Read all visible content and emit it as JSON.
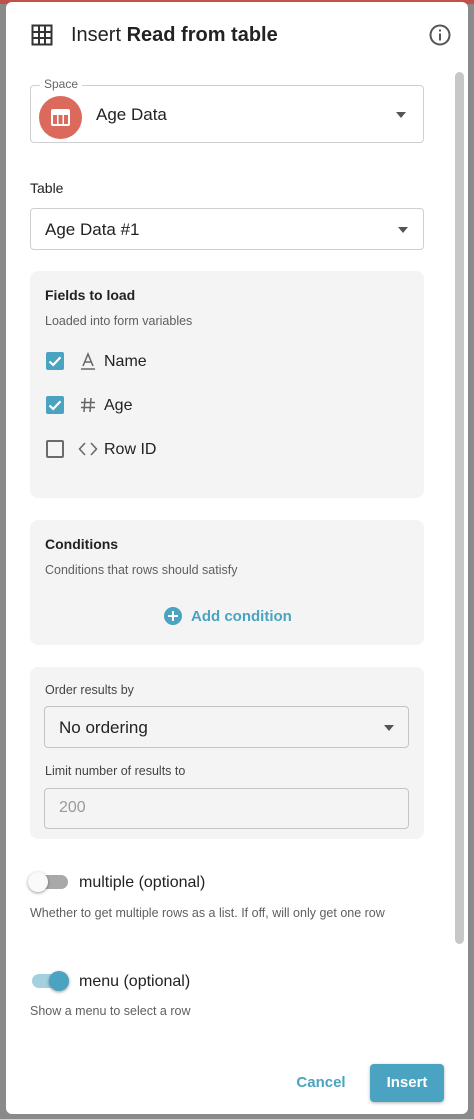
{
  "dialog": {
    "title_prefix": "Insert ",
    "title_bold": "Read from table",
    "title_icon": "table-grid-icon",
    "info_icon": "info-icon"
  },
  "space": {
    "legend": "Space",
    "value": "Age Data",
    "avatar_color": "#dc6a5c"
  },
  "table": {
    "label": "Table",
    "value": "Age Data #1"
  },
  "fields": {
    "title": "Fields to load",
    "subtitle": "Loaded into form variables",
    "items": [
      {
        "label": "Name",
        "icon": "A",
        "checked": true
      },
      {
        "label": "Age",
        "icon": "#",
        "checked": true
      },
      {
        "label": "Row ID",
        "icon": "<>",
        "checked": false
      }
    ]
  },
  "conditions": {
    "title": "Conditions",
    "subtitle": "Conditions that rows should satisfy",
    "add_label": "Add condition"
  },
  "ordering": {
    "order_label": "Order results by",
    "order_value": "No ordering",
    "limit_label": "Limit number of results to",
    "limit_placeholder": "200"
  },
  "options": {
    "multiple": {
      "label": "multiple (optional)",
      "help": "Whether to get multiple rows as a list. If off, will only get one row",
      "on": false
    },
    "menu": {
      "label": "menu (optional)",
      "help": "Show a menu to select a row",
      "on": true
    }
  },
  "actions": {
    "cancel": "Cancel",
    "insert": "Insert"
  },
  "colors": {
    "accent": "#4aa3c0",
    "panel_bg": "#f4f4f4"
  }
}
